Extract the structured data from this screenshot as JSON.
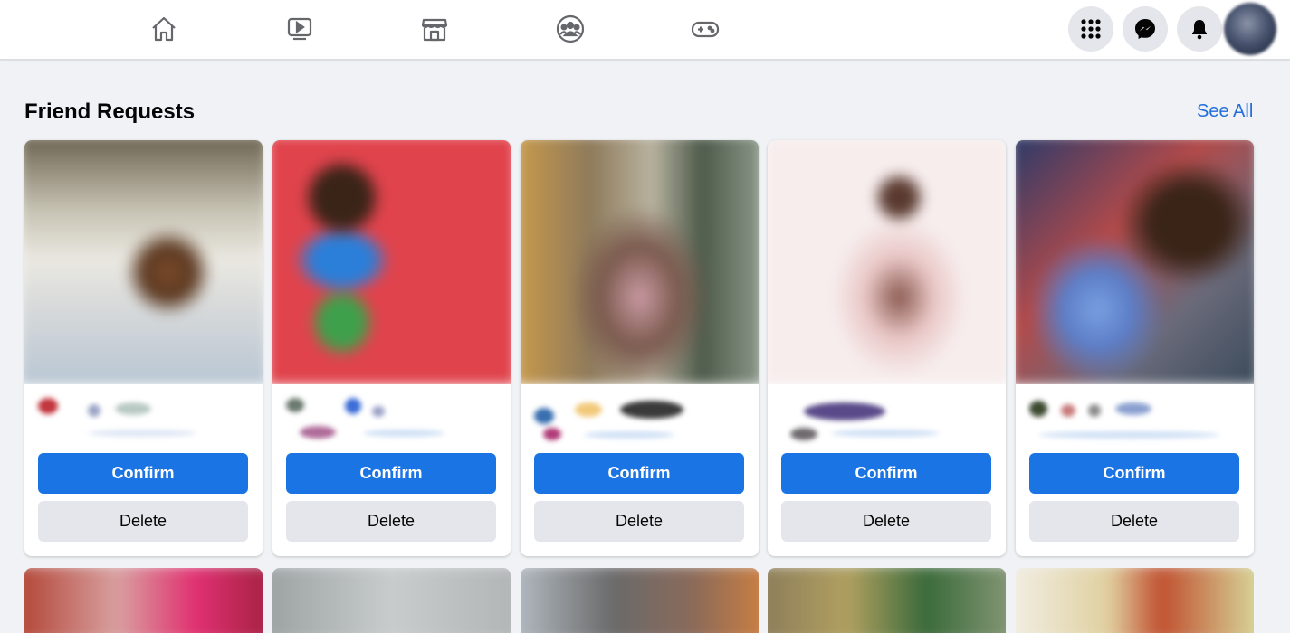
{
  "topbar": {
    "nav_icons": [
      "home-icon",
      "watch-icon",
      "marketplace-icon",
      "groups-icon",
      "gaming-icon"
    ],
    "right_buttons": [
      "menu-grid-icon",
      "messenger-icon",
      "notifications-bell-icon"
    ]
  },
  "friend_requests": {
    "title": "Friend Requests",
    "see_all": "See All",
    "cards": [
      {
        "confirm": "Confirm",
        "delete": "Delete"
      },
      {
        "confirm": "Confirm",
        "delete": "Delete"
      },
      {
        "confirm": "Confirm",
        "delete": "Delete"
      },
      {
        "confirm": "Confirm",
        "delete": "Delete"
      },
      {
        "confirm": "Confirm",
        "delete": "Delete"
      }
    ]
  },
  "colors": {
    "accent": "#1b74e4",
    "link": "#216fdb",
    "background": "#f0f2f5",
    "secondary_button": "#e4e6eb"
  }
}
